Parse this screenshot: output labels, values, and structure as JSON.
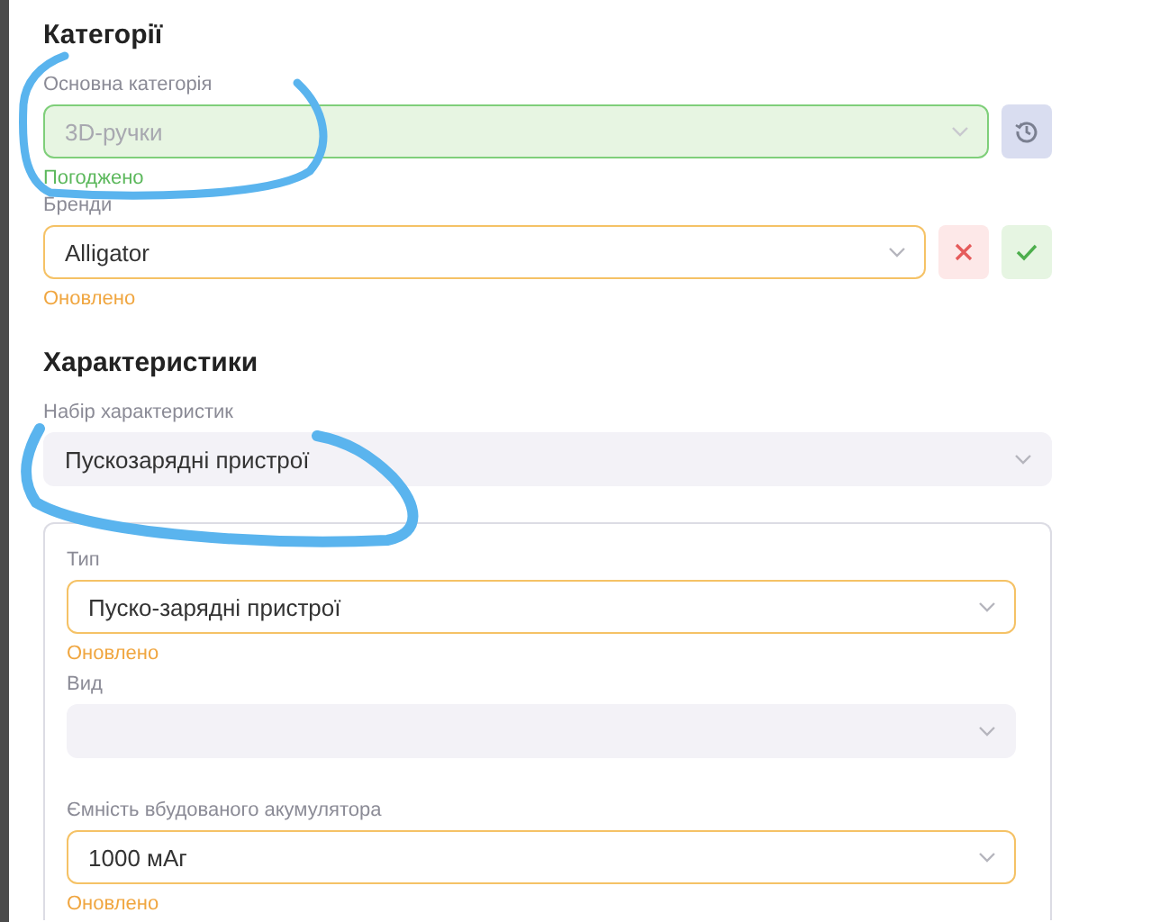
{
  "categories": {
    "title": "Категорії",
    "fields": [
      {
        "label": "Основна категорія",
        "value": "3D-ручки",
        "kind": "approved",
        "status_text": "Погоджено",
        "disabled": true,
        "actions": [
          {
            "kind": "history"
          }
        ]
      },
      {
        "label": "Бренди",
        "value": "Alligator",
        "kind": "updated",
        "status_text": "Оновлено",
        "disabled": false,
        "actions": [
          {
            "kind": "reject"
          },
          {
            "kind": "accept"
          }
        ]
      }
    ]
  },
  "characteristics": {
    "title": "Характеристики",
    "set_field": {
      "label": "Набір характеристик",
      "value": "Пускозарядні пристрої",
      "kind": "plain"
    },
    "panel_fields": [
      {
        "label": "Тип",
        "value": "Пуско-зарядні пристрої",
        "kind": "updated",
        "status_text": "Оновлено"
      },
      {
        "label": "Вид",
        "kind": "plain"
      },
      {
        "label": "Ємність вбудованого акумулятора",
        "value": "1000 мАг",
        "kind": "updated",
        "status_text": "Оновлено"
      }
    ]
  },
  "annotations": [
    {
      "kind": "scribble",
      "color": "#5ab4ee"
    },
    {
      "kind": "scribble",
      "color": "#5ab4ee"
    }
  ]
}
